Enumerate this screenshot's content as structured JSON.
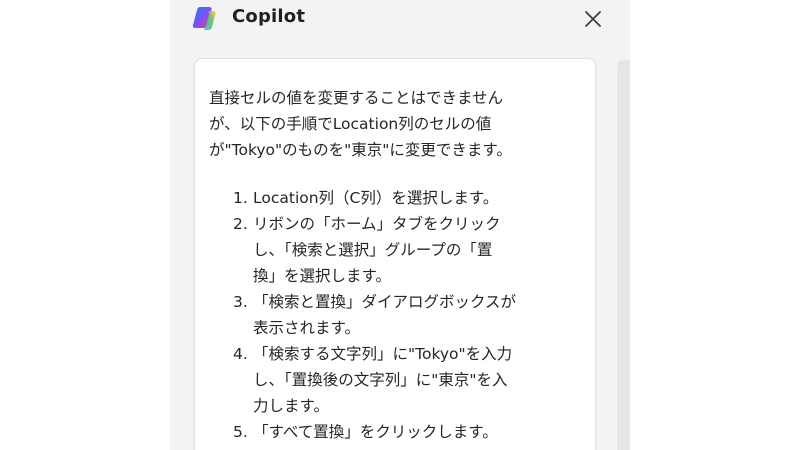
{
  "panel": {
    "title": "Copilot",
    "icons": {
      "logo": "copilot-logo",
      "close": "close-icon"
    }
  },
  "message": {
    "intro_lines": [
      "直接セルの値を変更することはできません",
      "が、以下の手順でLocation列のセルの値",
      "が\"Tokyo\"のものを\"東京\"に変更できます。"
    ],
    "steps": [
      {
        "num": "1.",
        "lines": [
          "Location列（C列）を選択します。"
        ]
      },
      {
        "num": "2.",
        "lines": [
          "リボンの「ホーム」タブをクリック",
          "し、「検索と選択」グループの「置",
          "換」を選択します。"
        ]
      },
      {
        "num": "3.",
        "lines": [
          "「検索と置換」ダイアログボックスが",
          "表示されます。"
        ]
      },
      {
        "num": "4.",
        "lines": [
          "「検索する文字列」に\"Tokyo\"を入力",
          "し、「置換後の文字列」に\"東京\"を入",
          "力します。"
        ]
      },
      {
        "num": "5.",
        "lines": [
          "「すべて置換」をクリックします。"
        ]
      }
    ]
  },
  "colors": {
    "panel_bg": "#f3f3f3",
    "card_bg": "#ffffff",
    "text": "#262626"
  }
}
